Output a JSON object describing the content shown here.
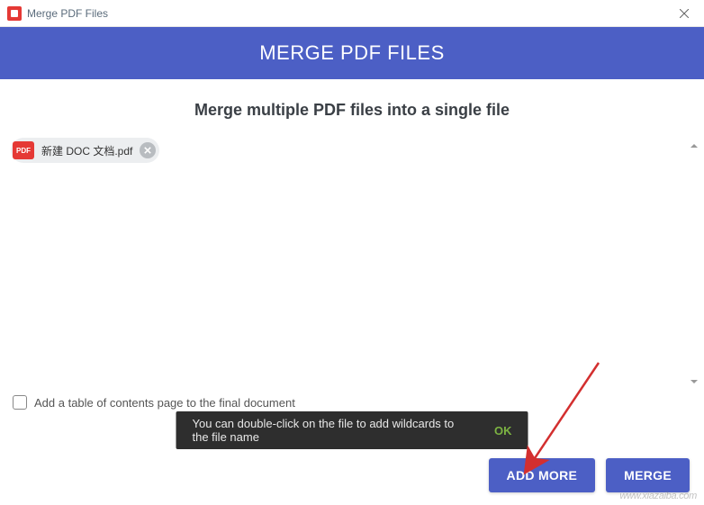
{
  "window": {
    "title": "Merge PDF Files"
  },
  "header": {
    "title": "MERGE PDF FILES"
  },
  "subtitle": "Merge multiple PDF files into a single file",
  "files": [
    {
      "badge": "PDF",
      "name": "新建 DOC 文档.pdf"
    }
  ],
  "options": {
    "toc_label": "Add a table of contents page to the final document"
  },
  "toast": {
    "text": "You can double-click on the file to add wildcards to the file name",
    "ok": "OK"
  },
  "buttons": {
    "add_more": "ADD MORE",
    "merge": "MERGE"
  },
  "watermark": "www.xiazaiba.com"
}
